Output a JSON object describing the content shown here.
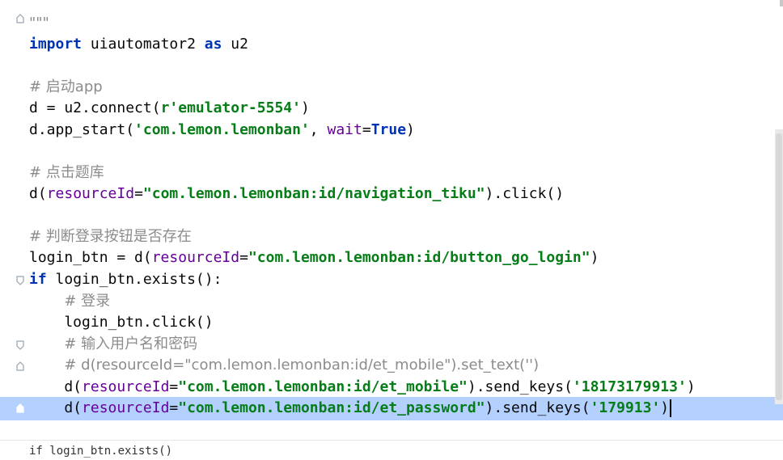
{
  "editor": {
    "lines": [
      {
        "id": "docstring_end",
        "parts": [
          {
            "t": "cmt",
            "v": "\"\"\""
          }
        ]
      },
      {
        "id": "import_line",
        "parts": [
          {
            "t": "kw",
            "v": "import"
          },
          {
            "t": "txt",
            "v": " uiautomator2 "
          },
          {
            "t": "kw",
            "v": "as"
          },
          {
            "t": "txt",
            "v": " u2"
          }
        ]
      },
      {
        "id": "blank1",
        "parts": []
      },
      {
        "id": "comment_launch",
        "parts": [
          {
            "t": "cmt",
            "v": "# 启动app"
          }
        ]
      },
      {
        "id": "connect_line",
        "parts": [
          {
            "t": "txt",
            "v": "d = u2.connect("
          },
          {
            "t": "str",
            "v": "r'emulator-5554'"
          },
          {
            "t": "txt",
            "v": ")"
          }
        ]
      },
      {
        "id": "app_start_line",
        "parts": [
          {
            "t": "txt",
            "v": "d.app_start("
          },
          {
            "t": "str",
            "v": "'com.lemon.lemonban'"
          },
          {
            "t": "txt",
            "v": ", "
          },
          {
            "t": "param",
            "v": "wait"
          },
          {
            "t": "txt",
            "v": "="
          },
          {
            "t": "kw",
            "v": "True"
          },
          {
            "t": "txt",
            "v": ")"
          }
        ]
      },
      {
        "id": "blank2",
        "parts": []
      },
      {
        "id": "comment_tiku",
        "parts": [
          {
            "t": "cmt",
            "v": "# 点击题库"
          }
        ]
      },
      {
        "id": "tiku_click_line",
        "parts": [
          {
            "t": "txt",
            "v": "d("
          },
          {
            "t": "param",
            "v": "resourceId"
          },
          {
            "t": "txt",
            "v": "="
          },
          {
            "t": "str",
            "v": "\"com.lemon.lemonban:id/navigation_tiku\""
          },
          {
            "t": "txt",
            "v": ").click()"
          }
        ]
      },
      {
        "id": "blank3",
        "parts": []
      },
      {
        "id": "comment_check_login",
        "parts": [
          {
            "t": "cmt",
            "v": "# 判断登录按钮是否存在"
          }
        ]
      },
      {
        "id": "login_btn_assign",
        "parts": [
          {
            "t": "txt",
            "v": "login_btn = d("
          },
          {
            "t": "param",
            "v": "resourceId"
          },
          {
            "t": "txt",
            "v": "="
          },
          {
            "t": "str",
            "v": "\"com.lemon.lemonban:id/button_go_login\""
          },
          {
            "t": "txt",
            "v": ")"
          }
        ]
      },
      {
        "id": "if_exists_line",
        "parts": [
          {
            "t": "kw",
            "v": "if"
          },
          {
            "t": "txt",
            "v": " login_btn.exists():"
          }
        ]
      },
      {
        "id": "comment_login",
        "parts": [
          {
            "t": "txt",
            "v": "    "
          },
          {
            "t": "cmt",
            "v": "# 登录"
          }
        ]
      },
      {
        "id": "login_click_line",
        "parts": [
          {
            "t": "txt",
            "v": "    login_btn.click()"
          }
        ]
      },
      {
        "id": "comment_input",
        "parts": [
          {
            "t": "txt",
            "v": "    "
          },
          {
            "t": "cmt",
            "v": "# 输入用户名和密码"
          }
        ]
      },
      {
        "id": "commented_set_text",
        "parts": [
          {
            "t": "txt",
            "v": "    "
          },
          {
            "t": "cmt",
            "v": "# d(resourceId=\"com.lemon.lemonban:id/et_mobile\").set_text('')"
          }
        ]
      },
      {
        "id": "mobile_line",
        "parts": [
          {
            "t": "txt",
            "v": "    d("
          },
          {
            "t": "param",
            "v": "resourceId"
          },
          {
            "t": "txt",
            "v": "="
          },
          {
            "t": "str",
            "v": "\"com.lemon.lemonban:id/et_mobile\""
          },
          {
            "t": "txt",
            "v": ").send_keys("
          },
          {
            "t": "str",
            "v": "'18173179913'"
          },
          {
            "t": "txt",
            "v": ")"
          }
        ]
      },
      {
        "id": "password_line",
        "parts": [
          {
            "t": "txt",
            "v": "    d("
          },
          {
            "t": "param",
            "v": "resourceId"
          },
          {
            "t": "txt",
            "v": "="
          },
          {
            "t": "str",
            "v": "\"com.lemon.lemonban:id/et_password\""
          },
          {
            "t": "txt",
            "v": ").send_keys("
          },
          {
            "t": "str",
            "v": "'179913'"
          },
          {
            "t": "txt",
            "v": ")"
          }
        ]
      }
    ]
  },
  "statusbar": {
    "breadcrumb": "if login_btn.exists()"
  },
  "colors": {
    "keyword": "#0033b3",
    "string": "#067d17",
    "comment": "#8c8c8c",
    "param": "#660099",
    "selection": "#a6c8ff"
  }
}
